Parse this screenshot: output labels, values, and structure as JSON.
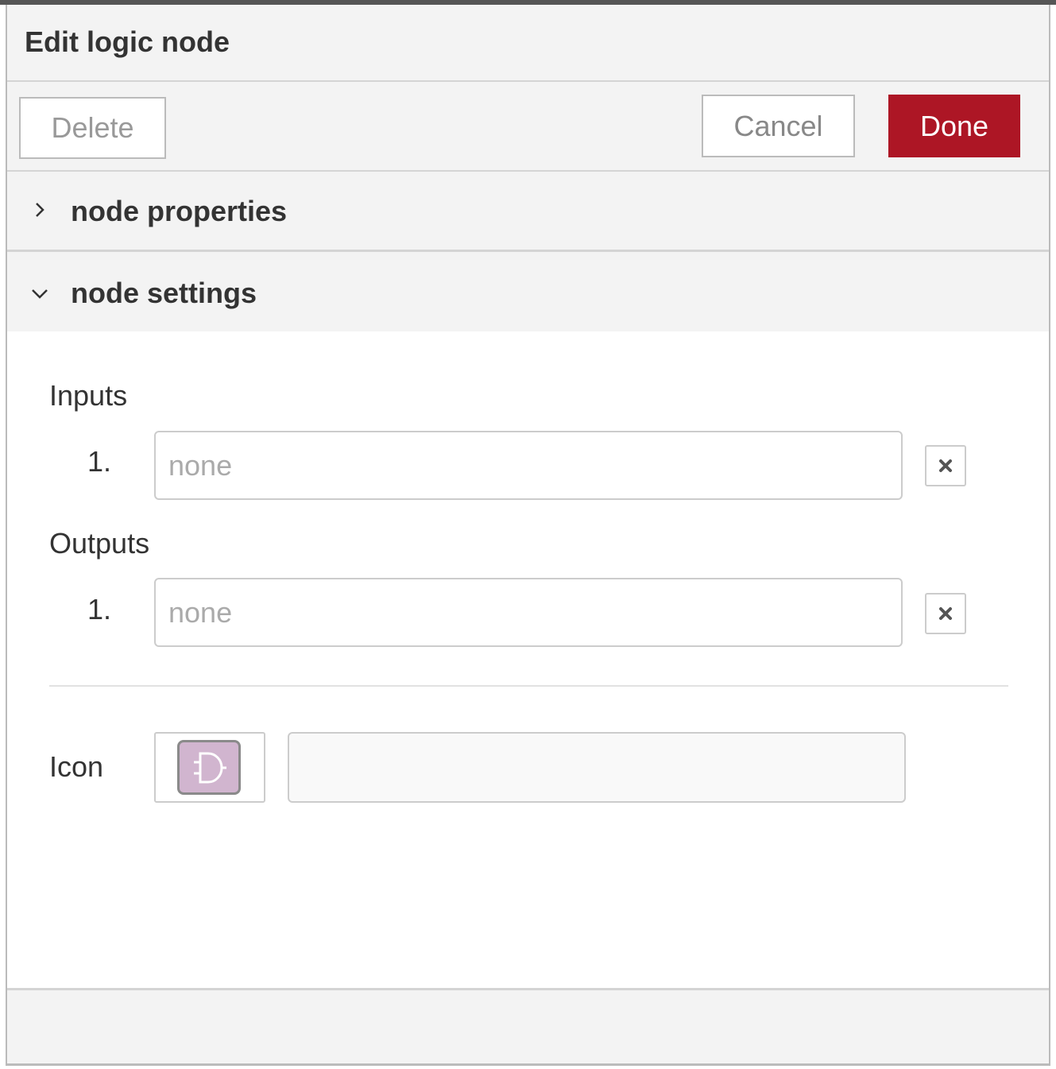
{
  "dialog": {
    "title": "Edit logic node"
  },
  "toolbar": {
    "delete_label": "Delete",
    "cancel_label": "Cancel",
    "done_label": "Done"
  },
  "sections": {
    "properties": {
      "label": "node properties",
      "expanded": false,
      "chevron_icon": "chevron-right-icon"
    },
    "settings": {
      "label": "node settings",
      "expanded": true,
      "chevron_icon": "chevron-down-icon"
    }
  },
  "settings": {
    "inputs": {
      "label": "Inputs",
      "rows": [
        {
          "index": "1.",
          "value": "",
          "placeholder": "none"
        }
      ]
    },
    "outputs": {
      "label": "Outputs",
      "rows": [
        {
          "index": "1.",
          "value": "",
          "placeholder": "none"
        }
      ]
    },
    "icon": {
      "label": "Icon",
      "icon_name": "logic-and-gate-icon",
      "tile_color": "#d1b5cf",
      "path_value": ""
    }
  },
  "colors": {
    "accent": "#ad1625",
    "header_bg": "#f3f3f3",
    "border": "#cccccc"
  }
}
